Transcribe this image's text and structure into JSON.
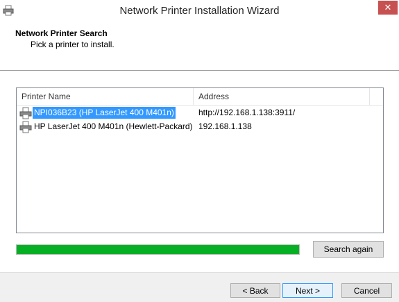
{
  "window": {
    "title": "Network Printer Installation Wizard",
    "close_glyph": "✕"
  },
  "header": {
    "title": "Network Printer Search",
    "subtitle": "Pick a printer to install."
  },
  "list": {
    "columns": [
      "Printer Name",
      "Address"
    ],
    "rows": [
      {
        "name": "NPI036B23 (HP LaserJet 400 M401n)",
        "address": "http://192.168.1.138:3911/",
        "selected": true,
        "icon": "printer-icon"
      },
      {
        "name": "HP LaserJet 400 M401n (Hewlett-Packard)",
        "address": "192.168.1.138",
        "selected": false,
        "icon": "printer-icon"
      }
    ]
  },
  "progress": {
    "value": 1.0,
    "color": "#06b025"
  },
  "buttons": {
    "search_again": "Search again",
    "back": "< Back",
    "next": "Next >",
    "cancel": "Cancel"
  },
  "colors": {
    "selection": "#3399ff",
    "close": "#c75050"
  }
}
